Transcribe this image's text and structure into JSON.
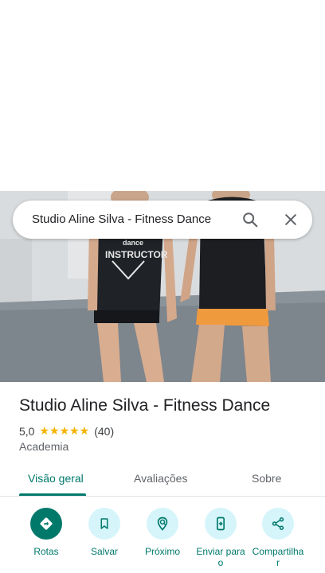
{
  "search": {
    "query": "Studio Aline Silva - Fitness Dance"
  },
  "place": {
    "name": "Studio Aline Silva - Fitness Dance",
    "rating": "5,0",
    "stars": "★★★★★",
    "reviews": "(40)",
    "category": "Academia"
  },
  "photo": {
    "shirt_text_1": "dance",
    "shirt_text_2": "INSTRUCTOR"
  },
  "tabs": [
    {
      "label": "Visão geral",
      "active": true
    },
    {
      "label": "Avaliações",
      "active": false
    },
    {
      "label": "Sobre",
      "active": false
    }
  ],
  "actions": [
    {
      "label": "Rotas",
      "icon": "directions-icon"
    },
    {
      "label": "Salvar",
      "icon": "bookmark-icon"
    },
    {
      "label": "Próximo",
      "icon": "nearby-icon"
    },
    {
      "label": "Enviar para o",
      "icon": "send-to-phone-icon"
    },
    {
      "label": "Compartilhar",
      "icon": "share-icon"
    }
  ],
  "colors": {
    "accent": "#00796b",
    "action_bg": "#d5f5fb",
    "star": "#f5b400",
    "text": "#202124",
    "subtext": "#5f6368"
  }
}
